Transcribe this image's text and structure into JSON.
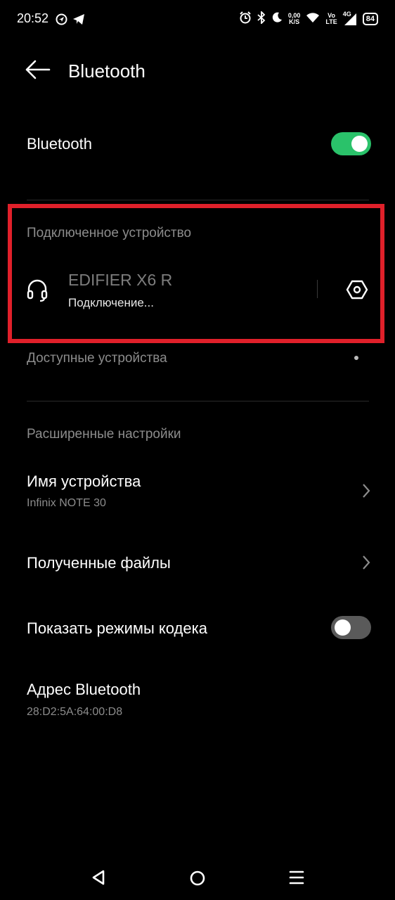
{
  "status_bar": {
    "time": "20:52",
    "net_speed_value": "0,00",
    "net_speed_unit": "K/S",
    "volte_top": "Vo",
    "volte_bottom": "LTE",
    "network": "4G",
    "battery": "84",
    "icons": [
      "location-icon",
      "telegram-icon",
      "alarm-icon",
      "bluetooth-icon",
      "moon-icon",
      "wifi-icon",
      "signal-icon",
      "battery-icon"
    ]
  },
  "header": {
    "title": "Bluetooth"
  },
  "bluetooth": {
    "label": "Bluetooth",
    "enabled": true
  },
  "connected": {
    "section_title": "Подключенное устройство",
    "device": {
      "name": "EDIFIER X6 R",
      "status": "Подключение...",
      "icon": "headphones-icon"
    }
  },
  "available": {
    "section_title": "Доступные устройства"
  },
  "advanced": {
    "section_title": "Расширенные настройки",
    "device_name": {
      "title": "Имя устройства",
      "value": "Infinix NOTE 30"
    },
    "received_files": {
      "title": "Полученные файлы"
    },
    "codec": {
      "title": "Показать режимы кодека",
      "enabled": false
    },
    "address": {
      "title": "Адрес Bluetooth",
      "value": "28:D2:5A:64:00:D8"
    }
  },
  "colors": {
    "toggle_on": "#2ac26a",
    "highlight": "#e0202a"
  }
}
